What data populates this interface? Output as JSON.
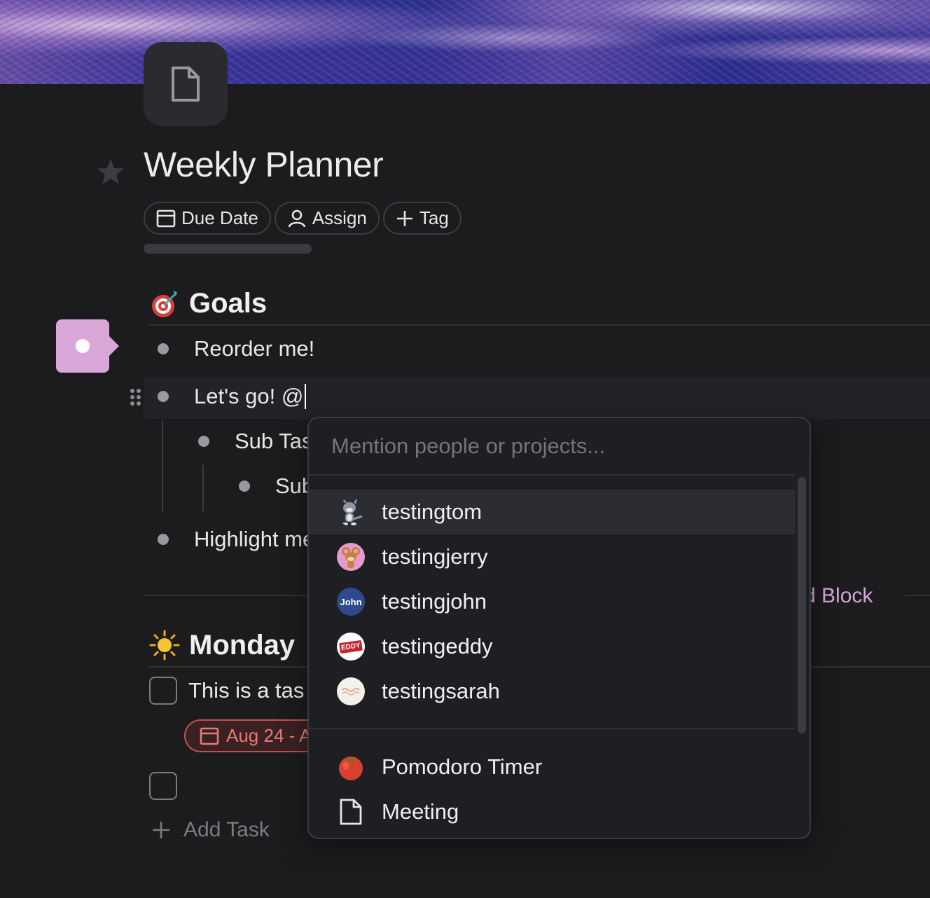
{
  "page": {
    "title": "Weekly Planner",
    "chips": {
      "due_date": "Due Date",
      "assign": "Assign",
      "tag": "Tag"
    }
  },
  "goals": {
    "heading": "Goals",
    "items": {
      "reorder": "Reorder me!",
      "lets_go": "Let's go! @",
      "sub_task": "Sub Tas",
      "sub_sub": "Sub",
      "highlight": "Highlight me"
    },
    "add_block": "d Block"
  },
  "monday": {
    "heading": "Monday",
    "task1": "This is a tas",
    "date_chip": "Aug 24 - A",
    "add_task": "Add Task"
  },
  "mention": {
    "placeholder": "Mention people or projects...",
    "people": [
      "testingtom",
      "testingjerry",
      "testingjohn",
      "testingeddy",
      "testingsarah"
    ],
    "projects": [
      "Pomodoro Timer",
      "Meeting"
    ],
    "john_avatar_text": "John",
    "eddy_avatar_text": "EDDY"
  },
  "colors": {
    "accent": "#d9a8d9",
    "date_red": "#e77b72",
    "background": "#1c1c1f"
  }
}
